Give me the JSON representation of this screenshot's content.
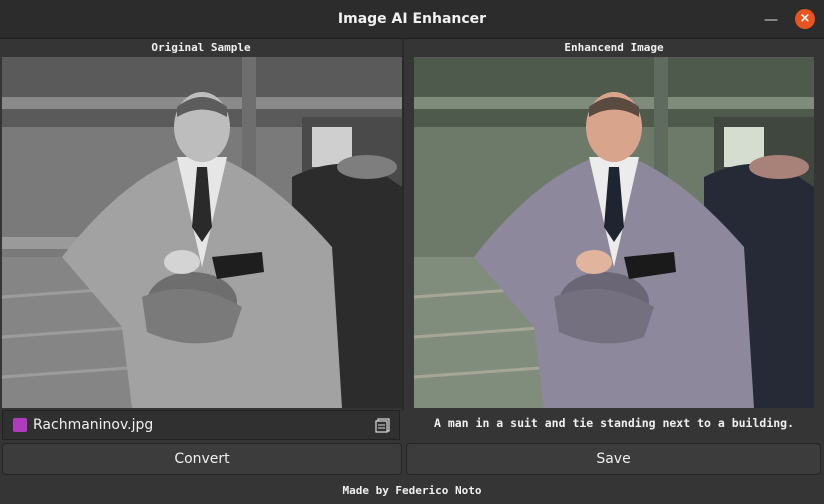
{
  "window": {
    "title": "Image AI Enhancer",
    "minimize_icon": "minimize-icon",
    "close_icon": "close-icon",
    "close_color": "#e95420"
  },
  "left_panel": {
    "title": "Original Sample",
    "file_name": "Rachmaninov.jpg",
    "file_icon": "image-file-icon",
    "browse_icon": "browse-file-icon"
  },
  "right_panel": {
    "title": "Enhancend Image",
    "caption": "A man in a suit and tie standing next to a building."
  },
  "buttons": {
    "convert": "Convert",
    "save": "Save"
  },
  "footer": {
    "text": "Made by Federico Noto"
  }
}
